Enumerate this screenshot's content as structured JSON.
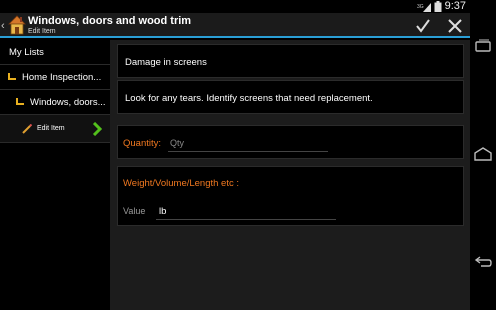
{
  "status_bar": {
    "time": "9:37",
    "network": "3G"
  },
  "action_bar": {
    "title": "Windows, doors and wood trim",
    "subtitle": "Edit Item",
    "accent": "#2a9fd6"
  },
  "sidebar": {
    "header": "My Lists",
    "items": [
      {
        "label": "Home Inspection..."
      },
      {
        "label": "Windows, doors..."
      }
    ],
    "edit_item": "Edit Item"
  },
  "form": {
    "name": "Damage in screens",
    "description": "Look for any tears. Identify screens that need replacement.",
    "quantity_label": "Quantity:",
    "quantity_placeholder": "Qty",
    "measure_label": "Weight/Volume/Length etc :",
    "value_label": "Value",
    "unit_value": "lb"
  },
  "colors": {
    "label": "#f07820",
    "check": "#53c01c"
  }
}
